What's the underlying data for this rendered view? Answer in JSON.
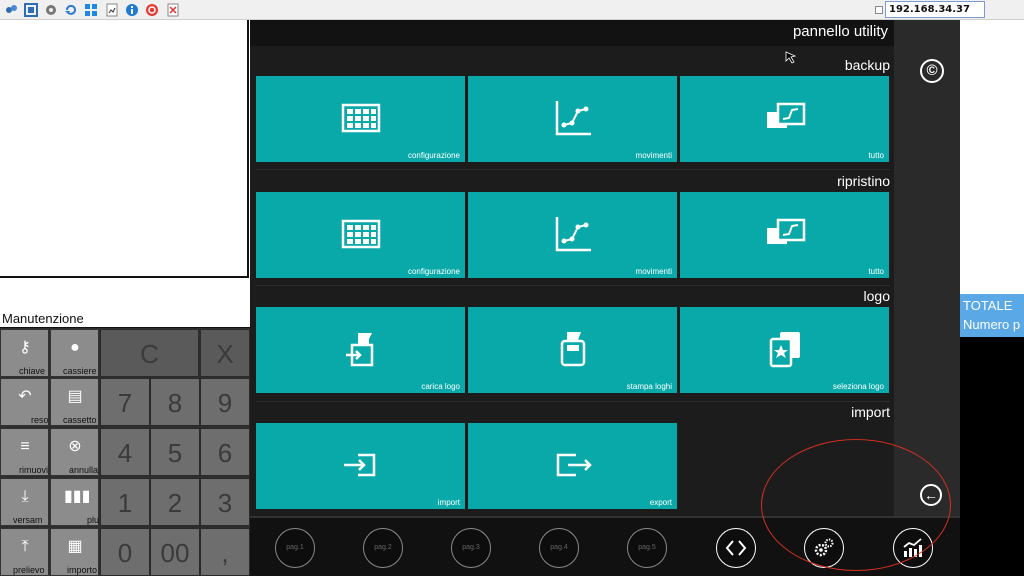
{
  "toolbar": {
    "icons": [
      "network-icon",
      "fullscreen-icon",
      "gear-icon",
      "refresh-icon",
      "windows-icon",
      "log-icon",
      "info-icon",
      "stop-icon",
      "clipboard-icon"
    ],
    "ip_address": "192.168.34.37"
  },
  "left": {
    "section_title": "Manutenzione",
    "function_keys": [
      {
        "label": "chiave",
        "icon": "key-icon"
      },
      {
        "label": "cassiere",
        "icon": "person-icon"
      },
      {
        "label": "reso",
        "icon": "return-arrow-icon"
      },
      {
        "label": "cassetto",
        "icon": "drawer-icon"
      },
      {
        "label": "rimuovi",
        "icon": "remove-list-icon"
      },
      {
        "label": "annulla",
        "icon": "cancel-coin-icon"
      },
      {
        "label": "versam",
        "icon": "deposit-icon"
      },
      {
        "label": "plu",
        "icon": "barcode-icon"
      },
      {
        "label": "prelievo",
        "icon": "withdraw-icon"
      },
      {
        "label": "importo",
        "icon": "amount-icon"
      }
    ],
    "keypad": {
      "clear": "C",
      "cancel": "X",
      "keys": [
        "7",
        "8",
        "9",
        "4",
        "5",
        "6",
        "1",
        "2",
        "3",
        "0",
        "00",
        ","
      ]
    }
  },
  "right_edge": {
    "totale": "TOTALE",
    "numero": "Numero p"
  },
  "panel": {
    "title": "pannello utility",
    "sections": [
      {
        "label": "backup",
        "tiles": [
          {
            "label": "configurazione",
            "icon": "grid-icon"
          },
          {
            "label": "movimenti",
            "icon": "line-chart-icon"
          },
          {
            "label": "tutto",
            "icon": "all-data-icon"
          }
        ]
      },
      {
        "label": "ripristino",
        "tiles": [
          {
            "label": "configurazione",
            "icon": "grid-icon"
          },
          {
            "label": "movimenti",
            "icon": "line-chart-icon"
          },
          {
            "label": "tutto",
            "icon": "all-data-icon"
          }
        ]
      },
      {
        "label": "logo",
        "tiles": [
          {
            "label": "carica logo",
            "icon": "upload-logo-icon"
          },
          {
            "label": "stampa loghi",
            "icon": "print-logo-icon"
          },
          {
            "label": "seleziona logo",
            "icon": "select-logo-icon"
          }
        ]
      },
      {
        "label": "import",
        "tiles": [
          {
            "label": "import",
            "icon": "import-icon"
          },
          {
            "label": "export",
            "icon": "export-icon"
          }
        ]
      }
    ],
    "sidebar": {
      "copyright": "©",
      "back": "←"
    },
    "nav_buttons": [
      {
        "label": "pag.1",
        "active": false
      },
      {
        "label": "pag.2",
        "active": false
      },
      {
        "label": "pag.3",
        "active": false
      },
      {
        "label": "pag.4",
        "active": false
      },
      {
        "label": "pag.5",
        "active": false
      },
      {
        "label": "",
        "icon": "code-brackets-icon",
        "active": true
      },
      {
        "label": "",
        "icon": "gears-icon",
        "active": true
      },
      {
        "label": "",
        "icon": "trend-chart-icon",
        "active": true
      }
    ]
  },
  "colors": {
    "tile": "#0aa9a9",
    "panel_bg": "#1c1c1c",
    "annotation": "#d03020",
    "totale": "#5aa8e6"
  }
}
